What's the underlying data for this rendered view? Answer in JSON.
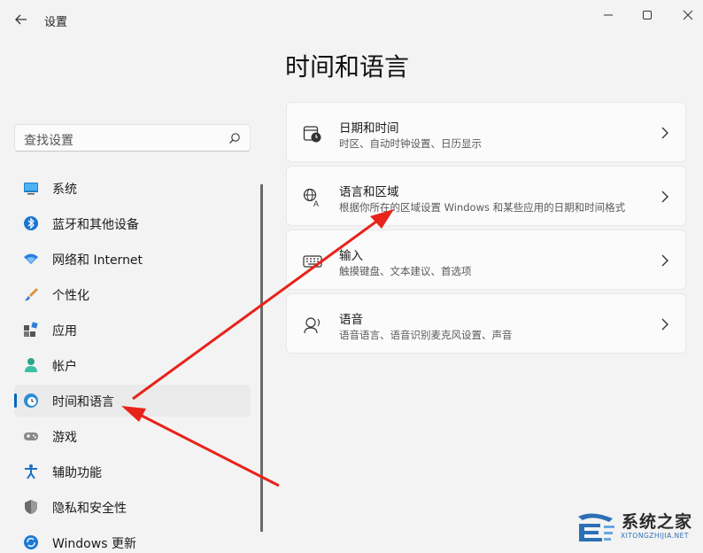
{
  "window": {
    "title": "设置"
  },
  "page": {
    "title": "时间和语言"
  },
  "search": {
    "placeholder": "查找设置"
  },
  "sidebar": {
    "items": [
      {
        "label": "系统",
        "icon": "monitor-icon"
      },
      {
        "label": "蓝牙和其他设备",
        "icon": "bluetooth-icon"
      },
      {
        "label": "网络和 Internet",
        "icon": "wifi-icon"
      },
      {
        "label": "个性化",
        "icon": "brush-icon"
      },
      {
        "label": "应用",
        "icon": "apps-icon"
      },
      {
        "label": "帐户",
        "icon": "person-icon"
      },
      {
        "label": "时间和语言",
        "icon": "globe-clock-icon",
        "active": true
      },
      {
        "label": "游戏",
        "icon": "gamepad-icon"
      },
      {
        "label": "辅助功能",
        "icon": "accessibility-icon"
      },
      {
        "label": "隐私和安全性",
        "icon": "shield-icon"
      },
      {
        "label": "Windows 更新",
        "icon": "update-icon"
      }
    ]
  },
  "cards": [
    {
      "title": "日期和时间",
      "subtitle": "时区、自动时钟设置、日历显示",
      "icon": "calendar-clock-icon"
    },
    {
      "title": "语言和区域",
      "subtitle": "根据你所在的区域设置 Windows 和某些应用的日期和时间格式",
      "icon": "language-icon"
    },
    {
      "title": "输入",
      "subtitle": "触摸键盘、文本建议、首选项",
      "icon": "keyboard-icon"
    },
    {
      "title": "语音",
      "subtitle": "语音语言、语音识别麦克风设置、声音",
      "icon": "speech-icon"
    }
  ],
  "watermark": {
    "text": "系统之家",
    "url": "XITONGZHIJIA.NET"
  },
  "colors": {
    "accent": "#0067c0",
    "arrow": "#e8231b"
  }
}
